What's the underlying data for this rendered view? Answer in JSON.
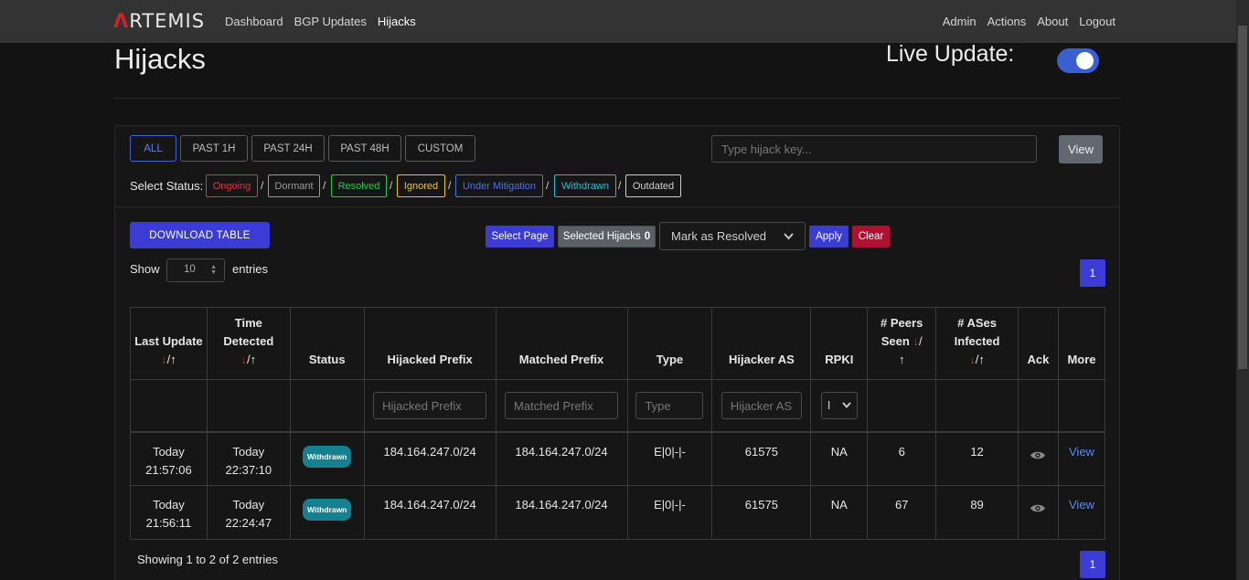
{
  "nav": {
    "brand_a": "Λ",
    "brand_rest": "RTEMIS",
    "left": [
      "Dashboard",
      "BGP Updates",
      "Hijacks"
    ],
    "right": [
      "Admin",
      "Actions",
      "About",
      "Logout"
    ]
  },
  "header": {
    "title": "Hijacks",
    "live_label": "Live Update:",
    "live_on": true
  },
  "time_filters": [
    "ALL",
    "PAST 1H",
    "PAST 24H",
    "PAST 48H",
    "CUSTOM"
  ],
  "search": {
    "placeholder": "Type hijack key...",
    "button": "View"
  },
  "status_filter": {
    "label": "Select Status:",
    "items": [
      {
        "label": "Ongoing",
        "color": "#dc3545"
      },
      {
        "label": "Dormant",
        "color": "#9a9a9a"
      },
      {
        "label": "Resolved",
        "color": "#28c850"
      },
      {
        "label": "Ignored",
        "color": "#f0c419"
      },
      {
        "label": "Under Mitigation",
        "color": "#4a73e8"
      },
      {
        "label": "Withdrawn",
        "color": "#17c1d6"
      },
      {
        "label": "Outdated",
        "color": "#cfcfcf"
      }
    ]
  },
  "actions": {
    "download": "DOWNLOAD TABLE",
    "select_page": "Select Page",
    "selected_label": "Selected Hijacks",
    "selected_count": "0",
    "mark_option": "Mark as Resolved",
    "apply": "Apply",
    "clear": "Clear"
  },
  "entries": {
    "show": "Show",
    "value": "10",
    "suffix": "entries"
  },
  "pagination": {
    "current": "1"
  },
  "table": {
    "headers": {
      "last_update": "Last Update",
      "time_detected": "Time Detected",
      "status": "Status",
      "hijacked_prefix": "Hijacked Prefix",
      "matched_prefix": "Matched Prefix",
      "type": "Type",
      "hijacker_as": "Hijacker AS",
      "rpki": "RPKI",
      "peers_seen": "# Peers Seen",
      "ases_infected": "# ASes Infected",
      "ack": "Ack",
      "more": "More"
    },
    "sort_down": "↓",
    "sort_sep": "/",
    "sort_up": "↑",
    "filters": {
      "hijacked_prefix": "Hijacked Prefix",
      "matched_prefix": "Matched Prefix",
      "type": "Type",
      "hijacker_as": "Hijacker AS",
      "rpki": "I"
    },
    "rows": [
      {
        "last_update_day": "Today",
        "last_update_time": "21:57:06",
        "detected_day": "Today",
        "detected_time": "22:37:10",
        "status": "Withdrawn",
        "hijacked_prefix": "184.164.247.0/24",
        "matched_prefix": "184.164.247.0/24",
        "type": "E|0|-|-",
        "hijacker_as": "61575",
        "rpki": "NA",
        "peers_seen": "6",
        "ases_infected": "12",
        "more": "View"
      },
      {
        "last_update_day": "Today",
        "last_update_time": "21:56:11",
        "detected_day": "Today",
        "detected_time": "22:24:47",
        "status": "Withdrawn",
        "hijacked_prefix": "184.164.247.0/24",
        "matched_prefix": "184.164.247.0/24",
        "type": "E|0|-|-",
        "hijacker_as": "61575",
        "rpki": "NA",
        "peers_seen": "67",
        "ases_infected": "89",
        "more": "View"
      }
    ]
  },
  "footer": {
    "showing": "Showing 1 to 2 of 2 entries"
  }
}
